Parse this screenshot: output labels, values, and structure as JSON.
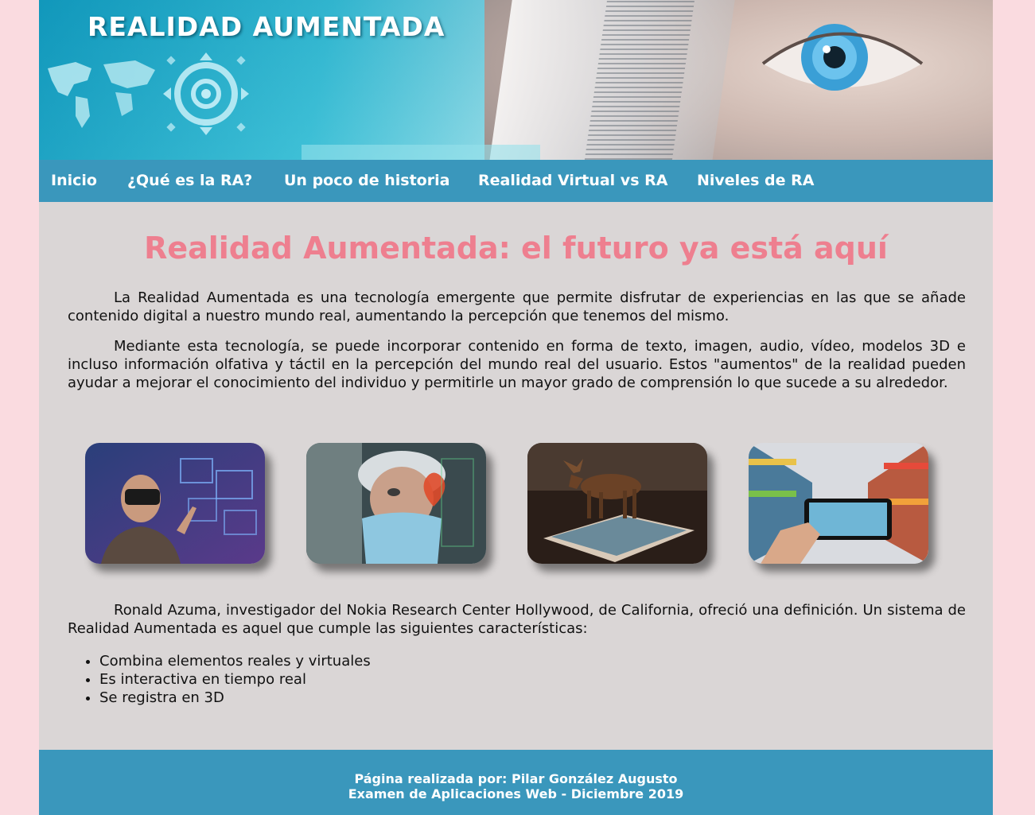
{
  "banner": {
    "title": "REALIDAD AUMENTADA"
  },
  "nav": {
    "items": [
      {
        "label": "Inicio"
      },
      {
        "label": "¿Qué es la RA?"
      },
      {
        "label": "Un poco de historia"
      },
      {
        "label": "Realidad Virtual vs RA"
      },
      {
        "label": "Niveles de RA"
      }
    ]
  },
  "main": {
    "title": "Realidad Aumentada: el futuro ya está aquí",
    "paragraphs": [
      "La Realidad Aumentada es una tecnología emergente que permite disfrutar de experiencias en las que se añade contenido digital a nuestro mundo real, aumentando la percepción que tenemos del mismo.",
      "Mediante esta tecnología, se puede incorporar contenido en forma de texto, imagen, audio, vídeo, modelos 3D e incluso información olfativa y táctil en la percepción del mundo real del usuario. Estos \"aumentos\" de la realidad pueden ayudar a mejorar el conocimiento del individuo y permitirle un mayor grado de comprensión lo que sucede a su alrededor.",
      "Ronald Azuma, investigador del Nokia Research Center Hollywood, de California, ofreció una definición. Un sistema de Realidad Aumentada es aquel que cumple las siguientes características:"
    ],
    "features": [
      "Combina elementos reales y virtuales",
      "Es interactiva en tiempo real",
      "Se registra en 3D"
    ]
  },
  "footer": {
    "line1": "Página realizada por: Pilar González Augusto",
    "line2": "Examen de Aplicaciones Web - Diciembre 2019"
  },
  "colors": {
    "page_bg": "#fadbe0",
    "content_bg": "#dad6d6",
    "nav_bg": "#3a97bc",
    "title_pink": "#ee7f8f"
  }
}
